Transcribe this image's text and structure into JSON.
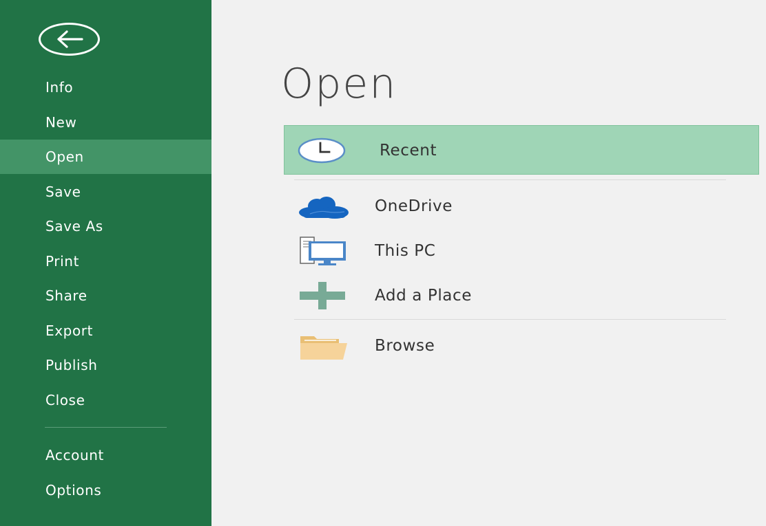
{
  "backstage": {
    "back_label": "Back",
    "nav_items": [
      {
        "label": "Info"
      },
      {
        "label": "New"
      },
      {
        "label": "Open",
        "active": true
      },
      {
        "label": "Save"
      },
      {
        "label": "Save As"
      },
      {
        "label": "Print"
      },
      {
        "label": "Share"
      },
      {
        "label": "Export"
      },
      {
        "label": "Publish"
      },
      {
        "label": "Close"
      }
    ],
    "footer_items": [
      {
        "label": "Account"
      },
      {
        "label": "Options"
      }
    ]
  },
  "main": {
    "title": "Open",
    "locations": [
      {
        "label": "Recent",
        "icon": "clock-icon",
        "selected": true
      },
      {
        "label": "OneDrive",
        "icon": "cloud-icon"
      },
      {
        "label": "This PC",
        "icon": "computer-icon"
      },
      {
        "label": "Add a Place",
        "icon": "plus-icon"
      },
      {
        "label": "Browse",
        "icon": "folder-icon"
      }
    ]
  },
  "colors": {
    "sidebar": "#217346",
    "sidebar_active": "#439467",
    "selected_location": "#9fd5b6",
    "main_background": "#f1f1f1"
  }
}
